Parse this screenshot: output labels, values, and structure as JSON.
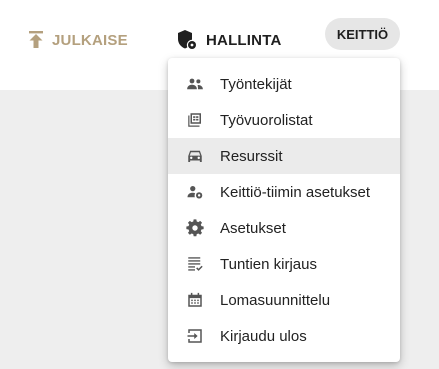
{
  "header": {
    "publish_label": "JULKAISE",
    "admin_label": "HALLINTA",
    "kitchen_label": "KEITTIÖ",
    "publish_color": "#b4a07e"
  },
  "menu": {
    "items": [
      {
        "label": "Työntekijät",
        "icon": "people-icon"
      },
      {
        "label": "Työvuorolistat",
        "icon": "shift-list-icon"
      },
      {
        "label": "Resurssit",
        "icon": "car-icon",
        "active": true
      },
      {
        "label": "Keittiö-tiimin asetukset",
        "icon": "team-settings-icon"
      },
      {
        "label": "Asetukset",
        "icon": "gear-icon"
      },
      {
        "label": "Tuntien kirjaus",
        "icon": "checklist-icon"
      },
      {
        "label": "Lomasuunnittelu",
        "icon": "calendar-icon"
      },
      {
        "label": "Kirjaudu ulos",
        "icon": "logout-icon"
      }
    ],
    "active_background": "#ebebeb"
  }
}
